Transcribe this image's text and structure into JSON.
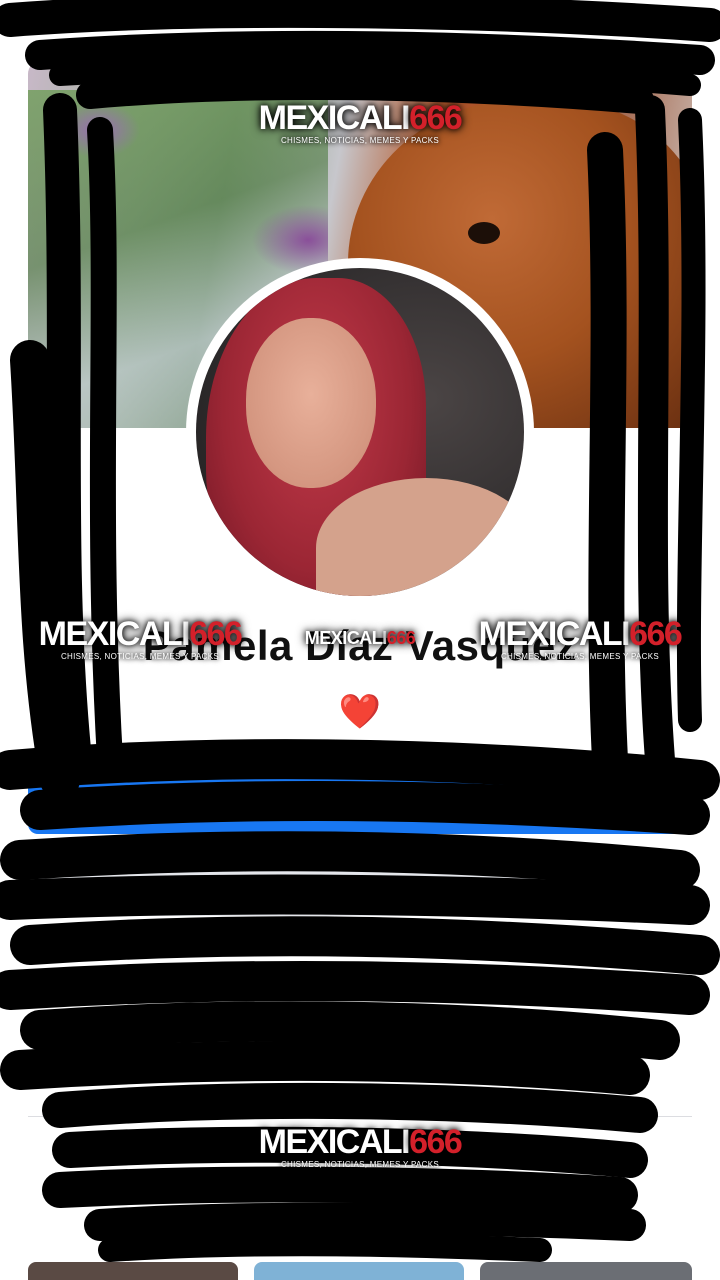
{
  "profile": {
    "name": "Pamela Díaz Vasquez",
    "bio": "❤️"
  },
  "watermark": {
    "title": "MEXICALI",
    "number": "666",
    "subtitle": "CHISMES, NOTICIAS, MEMES Y PACKS"
  },
  "colors": {
    "accent_blue": "#1877f2",
    "watermark_red": "#d3202a",
    "redaction": "#000000"
  }
}
